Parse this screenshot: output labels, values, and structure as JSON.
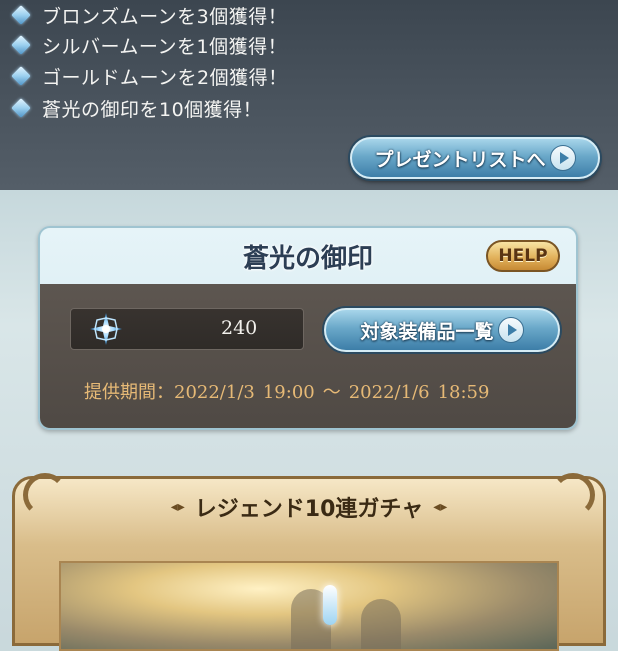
{
  "rewards": {
    "items": [
      {
        "text": "ブロンズムーンを3個獲得！",
        "icon": "gem-icon"
      },
      {
        "text": "シルバームーンを1個獲得！",
        "icon": "gem-icon"
      },
      {
        "text": "ゴールドムーンを2個獲得！",
        "icon": "gem-icon"
      },
      {
        "text": "蒼光の御印を10個獲得！",
        "icon": "gem-icon"
      }
    ],
    "present_button_label": "プレゼントリストへ"
  },
  "seal": {
    "title": "蒼光の御印",
    "help_label": "HELP",
    "count": "240",
    "equip_button_label": "対象装備品一覧",
    "period_label": "提供期間：2022/1/3",
    "period_start_time": "19:00",
    "period_sep": "〜",
    "period_end_date": "2022/1/6",
    "period_end_time": "18:59"
  },
  "gacha": {
    "title": "レジェンド10連ガチャ"
  },
  "colors": {
    "button_blue": "#6aa8c9",
    "help_gold": "#e2b25c",
    "period_text": "#e6b976"
  }
}
